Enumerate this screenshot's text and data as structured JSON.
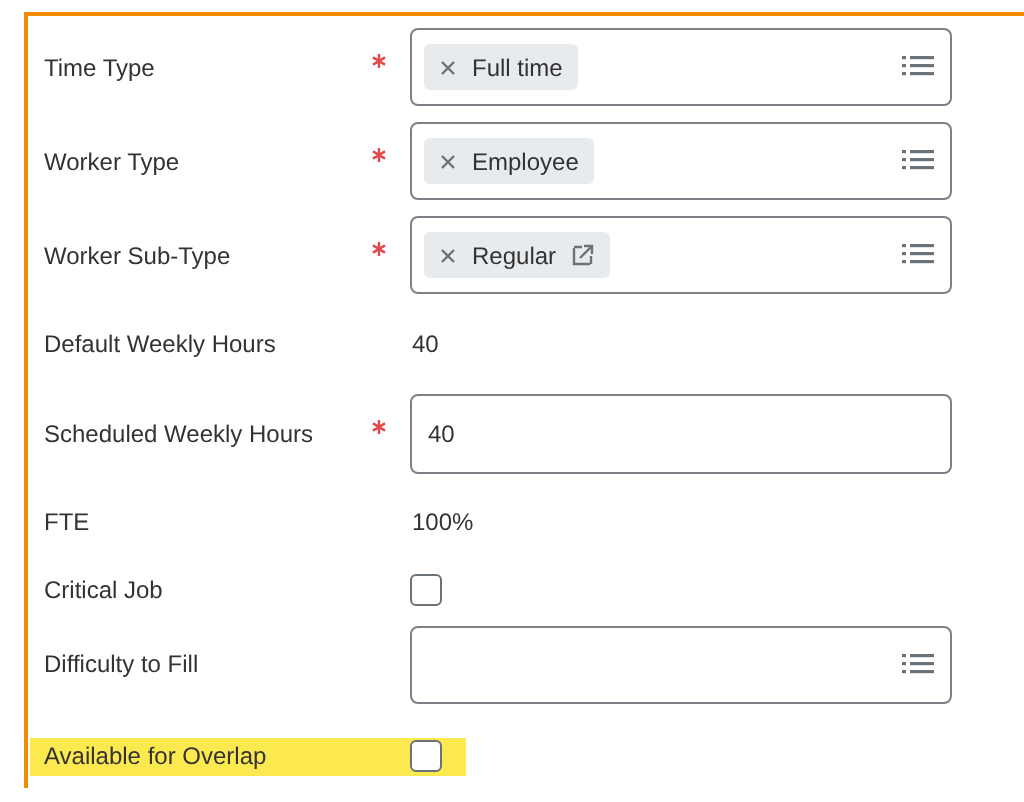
{
  "fields": [
    {
      "kind": "select",
      "label": "Time Type",
      "required": true,
      "highlighted": false,
      "chips": [
        {
          "text": "Full time",
          "link": false
        }
      ]
    },
    {
      "kind": "select",
      "label": "Worker Type",
      "required": true,
      "highlighted": false,
      "chips": [
        {
          "text": "Employee",
          "link": false
        }
      ]
    },
    {
      "kind": "select",
      "label": "Worker Sub-Type",
      "required": true,
      "highlighted": false,
      "chips": [
        {
          "text": "Regular",
          "link": true
        }
      ]
    },
    {
      "kind": "text",
      "label": "Default Weekly Hours",
      "required": false,
      "highlighted": false,
      "value": "40"
    },
    {
      "kind": "input",
      "label": "Scheduled Weekly Hours",
      "required": true,
      "highlighted": false,
      "value": "40"
    },
    {
      "kind": "text",
      "label": "FTE",
      "required": false,
      "highlighted": false,
      "value": "100%"
    },
    {
      "kind": "checkbox",
      "label": "Critical Job",
      "required": false,
      "highlighted": false,
      "checked": false
    },
    {
      "kind": "select",
      "label": "Difficulty to Fill",
      "required": false,
      "highlighted": false
    },
    {
      "kind": "checkbox",
      "label": "Available for Overlap",
      "required": false,
      "highlighted": true,
      "checked": false
    }
  ]
}
